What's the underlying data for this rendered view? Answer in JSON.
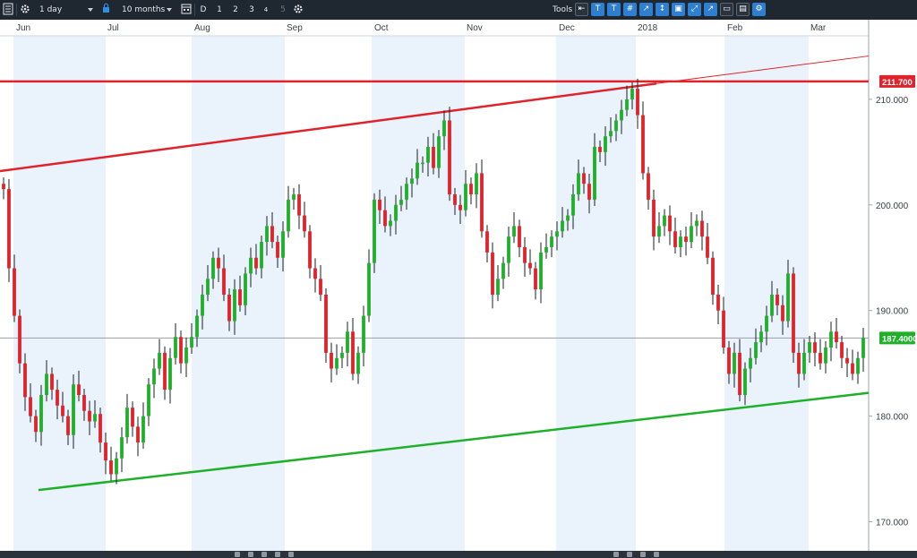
{
  "toolbar": {
    "interval": "1 day",
    "range": "10 months",
    "period_buttons": [
      "D",
      "1",
      "2",
      "3",
      "4",
      "5"
    ],
    "tools_label": "Tools",
    "icons": [
      "list-icon",
      "gear-icon",
      "lock-icon",
      "calendar-icon",
      "settings-icon",
      "arrow-left-icon",
      "text-icon",
      "trend-text-icon",
      "crosshair-icon",
      "marker-icon",
      "vertical-arrow-icon",
      "zoom-icon",
      "diagonal-zoom-icon",
      "diagonal-arrow-icon",
      "magnet-icon",
      "shape-icon",
      "print-icon",
      "tools-settings-icon"
    ]
  },
  "colors": {
    "background": "#ffffff",
    "band": "#eaf3fc",
    "up_candle": "#1fb02a",
    "down_candle": "#e0222a",
    "resistance": "#e0222a",
    "support": "#1fb02a",
    "axis_bg": "#ffffff",
    "toolbar_bg": "#1f2730"
  },
  "chart_data": {
    "type": "candlestick",
    "x_labels": [
      "Jun",
      "Jul",
      "Aug",
      "Sep",
      "Oct",
      "Nov",
      "Dec",
      "2018",
      "Feb",
      "Mar"
    ],
    "y_ticks": [
      "210.000",
      "200.000",
      "190.000",
      "180.000",
      "170.000"
    ],
    "ylim": [
      166.0,
      213.0
    ],
    "price_tags": [
      {
        "label": "211.700",
        "value": 211.7,
        "color": "#e0222a"
      },
      {
        "label": "187.4000",
        "value": 187.4,
        "color": "#1fb02a"
      }
    ],
    "closes": [
      201.5,
      194.0,
      189.5,
      185.0,
      181.8,
      180.0,
      178.5,
      182.0,
      184.0,
      182.5,
      181.0,
      180.0,
      178.2,
      183.0,
      182.0,
      180.5,
      179.5,
      180.2,
      177.5,
      175.8,
      174.5,
      176.0,
      178.0,
      180.8,
      179.0,
      177.5,
      180.0,
      183.0,
      184.5,
      186.0,
      182.5,
      185.5,
      187.5,
      185.0,
      186.5,
      187.5,
      189.5,
      191.5,
      193.0,
      195.0,
      194.0,
      191.5,
      189.0,
      192.0,
      190.5,
      193.5,
      195.0,
      194.0,
      196.5,
      198.0,
      196.5,
      195.0,
      197.5,
      200.5,
      201.0,
      199.0,
      197.5,
      194.0,
      193.0,
      191.5,
      186.0,
      184.5,
      185.5,
      186.0,
      188.0,
      184.0,
      186.0,
      189.5,
      194.5,
      200.5,
      199.5,
      198.0,
      198.5,
      200.0,
      200.5,
      202.0,
      202.5,
      204.0,
      204.0,
      205.5,
      203.5,
      206.5,
      208.0,
      201.0,
      200.0,
      199.5,
      202.0,
      201.0,
      203.0,
      197.5,
      195.5,
      191.5,
      193.0,
      194.5,
      197.0,
      198.0,
      196.0,
      194.5,
      194.0,
      192.0,
      195.5,
      196.0,
      197.0,
      197.5,
      198.5,
      199.0,
      201.0,
      203.0,
      202.0,
      200.5,
      205.5,
      205.0,
      206.5,
      207.0,
      208.0,
      209.0,
      210.0,
      211.0,
      208.5,
      203.0,
      200.5,
      197.0,
      198.0,
      199.0,
      197.5,
      196.0,
      197.0,
      196.5,
      198.0,
      198.5,
      197.0,
      195.0,
      191.5,
      190.0,
      186.5,
      184.0,
      186.0,
      182.0,
      184.5,
      185.5,
      187.0,
      188.0,
      189.5,
      191.5,
      190.5,
      189.0,
      193.5,
      186.0,
      184.0,
      186.0,
      187.0,
      186.0,
      185.0,
      186.5,
      188.0,
      187.0,
      185.5,
      185.0,
      184.0,
      185.5,
      187.4
    ],
    "resistance_line": {
      "x": [
        "Jun",
        "2018"
      ],
      "y": [
        203.0,
        211.5
      ]
    },
    "support_line": {
      "x": [
        "Jun",
        "Mar"
      ],
      "y": [
        173.0,
        182.0
      ]
    }
  }
}
